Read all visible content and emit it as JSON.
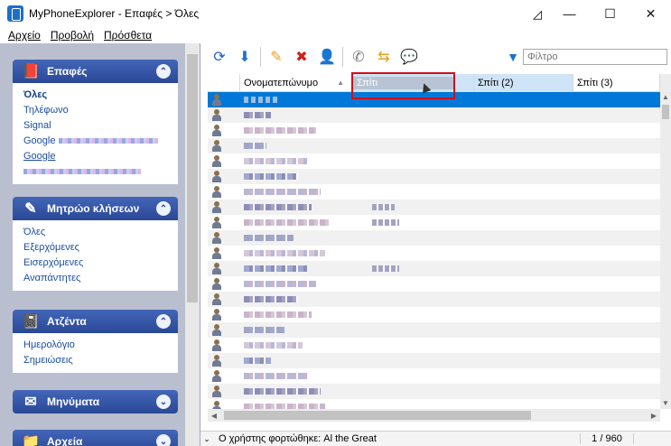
{
  "window": {
    "title": "MyPhoneExplorer - Επαφές > Όλες",
    "minimize": "—",
    "maximize": "☐",
    "close": "✕"
  },
  "menu": [
    "Αρχείο",
    "Προβολή",
    "Πρόσθετα"
  ],
  "sidebar": {
    "contacts": {
      "title": "Επαφές",
      "items": [
        "Όλες",
        "Τηλέφωνο",
        "Signal",
        "Google",
        "Google"
      ]
    },
    "calls": {
      "title": "Μητρώο κλήσεων",
      "items": [
        "Όλες",
        "Εξερχόμενες",
        "Εισερχόμενες",
        "Αναπάντητες"
      ]
    },
    "agenda": {
      "title": "Ατζέντα",
      "items": [
        "Ημερολόγιο",
        "Σημειώσεις"
      ]
    },
    "messages": {
      "title": "Μηνύματα"
    },
    "files": {
      "title": "Αρχεία"
    }
  },
  "toolbar": {
    "filter_placeholder": "Φίλτρο",
    "icons": [
      "refresh-icon",
      "download-icon",
      "edit-icon",
      "delete-icon",
      "add-contact-icon",
      "call-icon",
      "sync-icon",
      "message-icon"
    ]
  },
  "grid": {
    "columns": [
      "Ονοματεπώνυμο",
      "Σπίτι (2)",
      "Σπίτι (3)"
    ],
    "dragging_column": "Σπίτι"
  },
  "status": {
    "text": "Ο χρήστης φορτώθηκε: Al the Great",
    "count": "1 / 960"
  }
}
